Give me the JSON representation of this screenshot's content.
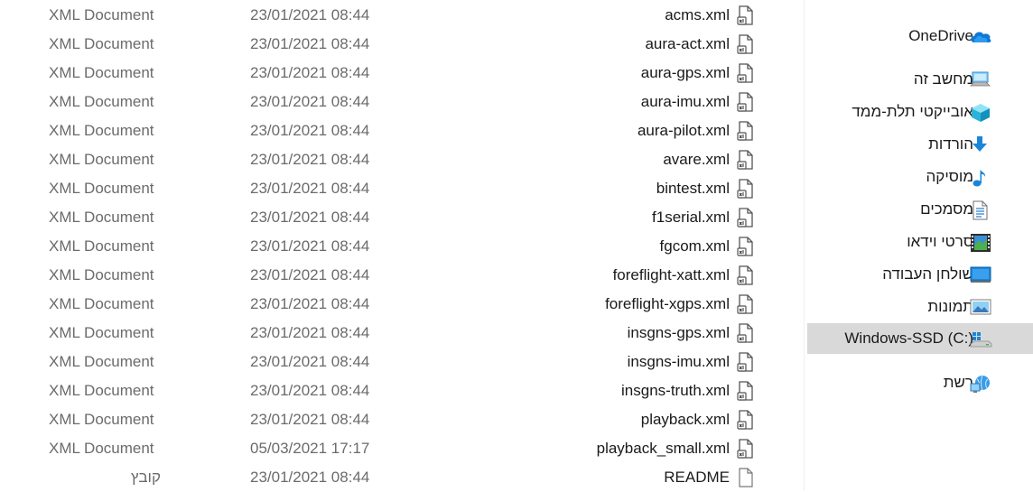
{
  "files": [
    {
      "name": "acms.xml",
      "date": "23/01/2021 08:44",
      "type": "XML Document",
      "icon": "xml-file-icon"
    },
    {
      "name": "aura-act.xml",
      "date": "23/01/2021 08:44",
      "type": "XML Document",
      "icon": "xml-file-icon"
    },
    {
      "name": "aura-gps.xml",
      "date": "23/01/2021 08:44",
      "type": "XML Document",
      "icon": "xml-file-icon"
    },
    {
      "name": "aura-imu.xml",
      "date": "23/01/2021 08:44",
      "type": "XML Document",
      "icon": "xml-file-icon"
    },
    {
      "name": "aura-pilot.xml",
      "date": "23/01/2021 08:44",
      "type": "XML Document",
      "icon": "xml-file-icon"
    },
    {
      "name": "avare.xml",
      "date": "23/01/2021 08:44",
      "type": "XML Document",
      "icon": "xml-file-icon"
    },
    {
      "name": "bintest.xml",
      "date": "23/01/2021 08:44",
      "type": "XML Document",
      "icon": "xml-file-icon"
    },
    {
      "name": "f1serial.xml",
      "date": "23/01/2021 08:44",
      "type": "XML Document",
      "icon": "xml-file-icon"
    },
    {
      "name": "fgcom.xml",
      "date": "23/01/2021 08:44",
      "type": "XML Document",
      "icon": "xml-file-icon"
    },
    {
      "name": "foreflight-xatt.xml",
      "date": "23/01/2021 08:44",
      "type": "XML Document",
      "icon": "xml-file-icon"
    },
    {
      "name": "foreflight-xgps.xml",
      "date": "23/01/2021 08:44",
      "type": "XML Document",
      "icon": "xml-file-icon"
    },
    {
      "name": "insgns-gps.xml",
      "date": "23/01/2021 08:44",
      "type": "XML Document",
      "icon": "xml-file-icon"
    },
    {
      "name": "insgns-imu.xml",
      "date": "23/01/2021 08:44",
      "type": "XML Document",
      "icon": "xml-file-icon"
    },
    {
      "name": "insgns-truth.xml",
      "date": "23/01/2021 08:44",
      "type": "XML Document",
      "icon": "xml-file-icon"
    },
    {
      "name": "playback.xml",
      "date": "23/01/2021 08:44",
      "type": "XML Document",
      "icon": "xml-file-icon"
    },
    {
      "name": "playback_small.xml",
      "date": "05/03/2021 17:17",
      "type": "XML Document",
      "icon": "xml-file-icon"
    },
    {
      "name": "README",
      "date": "23/01/2021 08:44",
      "type": "קובץ",
      "icon": "blank-file-icon"
    }
  ],
  "nav": {
    "items": [
      {
        "label": "OneDrive",
        "icon": "onedrive-cloud-icon",
        "selected": false
      },
      {
        "label": "מחשב זה",
        "icon": "this-pc-icon",
        "selected": false
      },
      {
        "label": "אובייקטי תלת-ממד",
        "icon": "3d-objects-icon",
        "selected": false
      },
      {
        "label": "הורדות",
        "icon": "downloads-arrow-icon",
        "selected": false
      },
      {
        "label": "מוסיקה",
        "icon": "music-note-icon",
        "selected": false
      },
      {
        "label": "מסמכים",
        "icon": "documents-icon",
        "selected": false
      },
      {
        "label": "סרטי וידאו",
        "icon": "videos-film-icon",
        "selected": false
      },
      {
        "label": "שולחן העבודה",
        "icon": "desktop-icon",
        "selected": false
      },
      {
        "label": "תמונות",
        "icon": "pictures-icon",
        "selected": false
      },
      {
        "label": "Windows-SSD (C:)",
        "icon": "windows-drive-icon",
        "selected": true
      },
      {
        "label": "רשת",
        "icon": "network-icon",
        "selected": false
      }
    ]
  },
  "colors": {
    "selection": "#d9d9d9",
    "secondary_text": "#6b6b6b",
    "accent_blue": "#1a86d9"
  }
}
